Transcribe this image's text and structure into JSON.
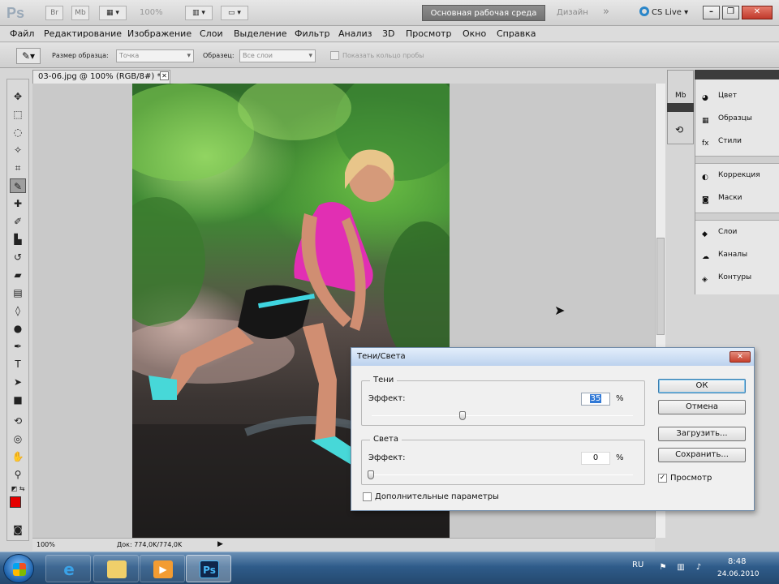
{
  "app": {
    "logo": "Ps",
    "zoom": "100%",
    "workspace_active": "Основная рабочая среда",
    "workspace_other": "Дизайн",
    "more_workspaces": "»",
    "cs_live": "CS Live",
    "tb_btn_br": "Br",
    "tb_btn_mb": "Mb"
  },
  "window_controls": {
    "minimize": "–",
    "restore": "❐",
    "close": "✕"
  },
  "menu": [
    "Файл",
    "Редактирование",
    "Изображение",
    "Слои",
    "Выделение",
    "Фильтр",
    "Анализ",
    "3D",
    "Просмотр",
    "Окно",
    "Справка"
  ],
  "options_bar": {
    "sample_size_label": "Размер образца:",
    "sample_size_value": "Точка",
    "sample_label": "Образец:",
    "sample_value": "Все слои",
    "show_ring_label": "Показать кольцо пробы"
  },
  "document": {
    "tab_title": "03-06.jpg @ 100% (RGB/8#) *",
    "tab_close": "✕",
    "status_zoom": "100%",
    "status_doc": "Док: 774,0K/774,0K",
    "status_arrow": "▶"
  },
  "panels": {
    "group1": [
      "Цвет",
      "Образцы",
      "Стили"
    ],
    "group2": [
      "Коррекция",
      "Маски"
    ],
    "group3": [
      "Слои",
      "Каналы",
      "Контуры"
    ]
  },
  "dialog": {
    "title": "Тени/Света",
    "close": "✕",
    "shadows": {
      "legend": "Тени",
      "effect_label": "Эффект:",
      "value": "35",
      "unit": "%",
      "slider_fraction": 0.35
    },
    "highlights": {
      "legend": "Света",
      "effect_label": "Эффект:",
      "value": "0",
      "unit": "%",
      "slider_fraction": 0.0
    },
    "more_options_label": "Дополнительные параметры",
    "more_options_checked": false,
    "buttons": {
      "ok": "ОК",
      "cancel": "Отмена",
      "load": "Загрузить...",
      "save": "Сохранить..."
    },
    "preview_label": "Просмотр",
    "preview_checked": true
  },
  "taskbar": {
    "language": "RU",
    "time": "8:48",
    "date": "24.06.2010",
    "ps_icon": "Ps"
  },
  "colors": {
    "foreground": "#e50000",
    "background": "#ffffff"
  }
}
